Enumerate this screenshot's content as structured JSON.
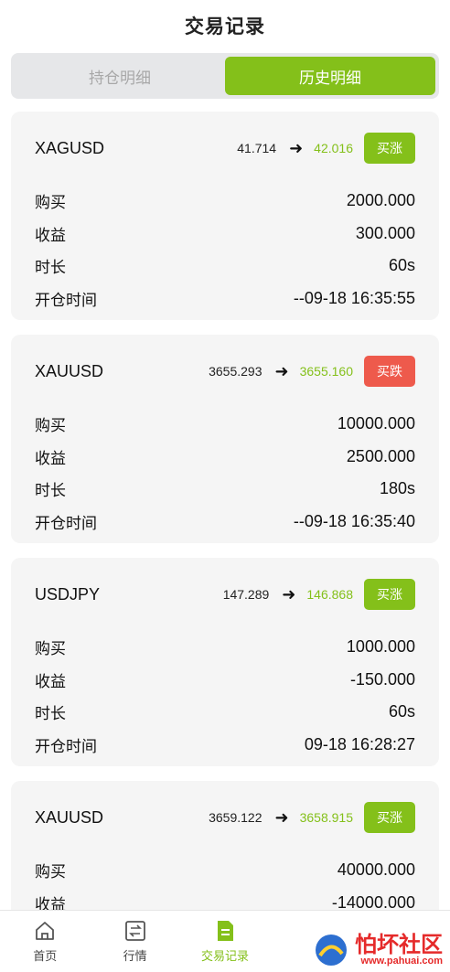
{
  "header": {
    "title": "交易记录"
  },
  "tabs": [
    {
      "label": "持仓明细",
      "active": false
    },
    {
      "label": "历史明细",
      "active": true
    }
  ],
  "labels": {
    "buy": "购买",
    "profit": "收益",
    "duration": "时长",
    "open_time": "开仓时间"
  },
  "records": [
    {
      "symbol": "XAGUSD",
      "open_price": "41.714",
      "close_price": "42.016",
      "direction": "买涨",
      "direction_type": "up",
      "amount": "2000.000",
      "profit": "300.000",
      "duration": "60s",
      "open_time": "--09-18 16:35:55"
    },
    {
      "symbol": "XAUUSD",
      "open_price": "3655.293",
      "close_price": "3655.160",
      "direction": "买跌",
      "direction_type": "down",
      "amount": "10000.000",
      "profit": "2500.000",
      "duration": "180s",
      "open_time": "--09-18 16:35:40"
    },
    {
      "symbol": "USDJPY",
      "open_price": "147.289",
      "close_price": "146.868",
      "direction": "买涨",
      "direction_type": "up",
      "amount": "1000.000",
      "profit": "-150.000",
      "duration": "60s",
      "open_time": "09-18 16:28:27"
    },
    {
      "symbol": "XAUUSD",
      "open_price": "3659.122",
      "close_price": "3658.915",
      "direction": "买涨",
      "direction_type": "up",
      "amount": "40000.000",
      "profit": "-14000.000",
      "duration": "",
      "open_time": ""
    }
  ],
  "tabbar": [
    {
      "label": "首页",
      "icon": "home-icon",
      "active": false
    },
    {
      "label": "行情",
      "icon": "exchange-icon",
      "active": false
    },
    {
      "label": "交易记录",
      "icon": "document-icon",
      "active": true
    }
  ],
  "watermark": {
    "text": "怕坏社区",
    "sub": "www.pahuai.com"
  },
  "colors": {
    "accent": "#84c01a",
    "down": "#ee5a4c",
    "card_bg": "#f5f5f5"
  }
}
